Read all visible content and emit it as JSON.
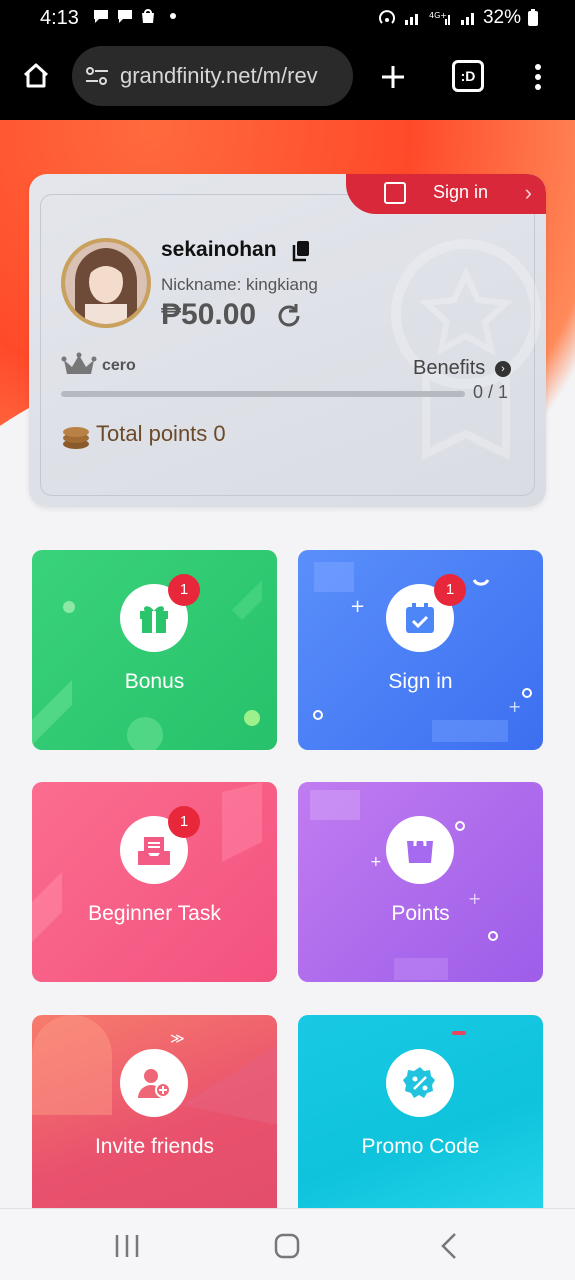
{
  "status": {
    "time": "4:13",
    "battery": "32%"
  },
  "browser": {
    "url": "grandfinity.net/m/rev",
    "tabs_label": ":D"
  },
  "card": {
    "signin_label": "Sign in",
    "username": "sekainohan",
    "nickname": "Nickname: kingkiang",
    "balance": "₱50.00",
    "vip_level": "cero",
    "benefits_label": "Benefits",
    "progress_text": "0 / 1",
    "progress_value": 0,
    "total_points": "Total points 0"
  },
  "tiles": [
    {
      "label": "Bonus",
      "badge": "1",
      "icon": "gift-icon",
      "color": "#39cf7a"
    },
    {
      "label": "Sign in",
      "badge": "1",
      "icon": "calendar-icon",
      "color": "#4f82f5"
    },
    {
      "label": "Beginner Task",
      "badge": "1",
      "icon": "inbox-icon",
      "color": "#f5648f"
    },
    {
      "label": "Points",
      "badge": "",
      "icon": "shopping-bag-icon",
      "color": "#a767ee"
    },
    {
      "label": "Invite friends",
      "badge": "",
      "icon": "add-user-icon",
      "color": "#f06a78"
    },
    {
      "label": "Promo Code",
      "badge": "",
      "icon": "discount-badge-icon",
      "color": "#18c6dd"
    }
  ]
}
